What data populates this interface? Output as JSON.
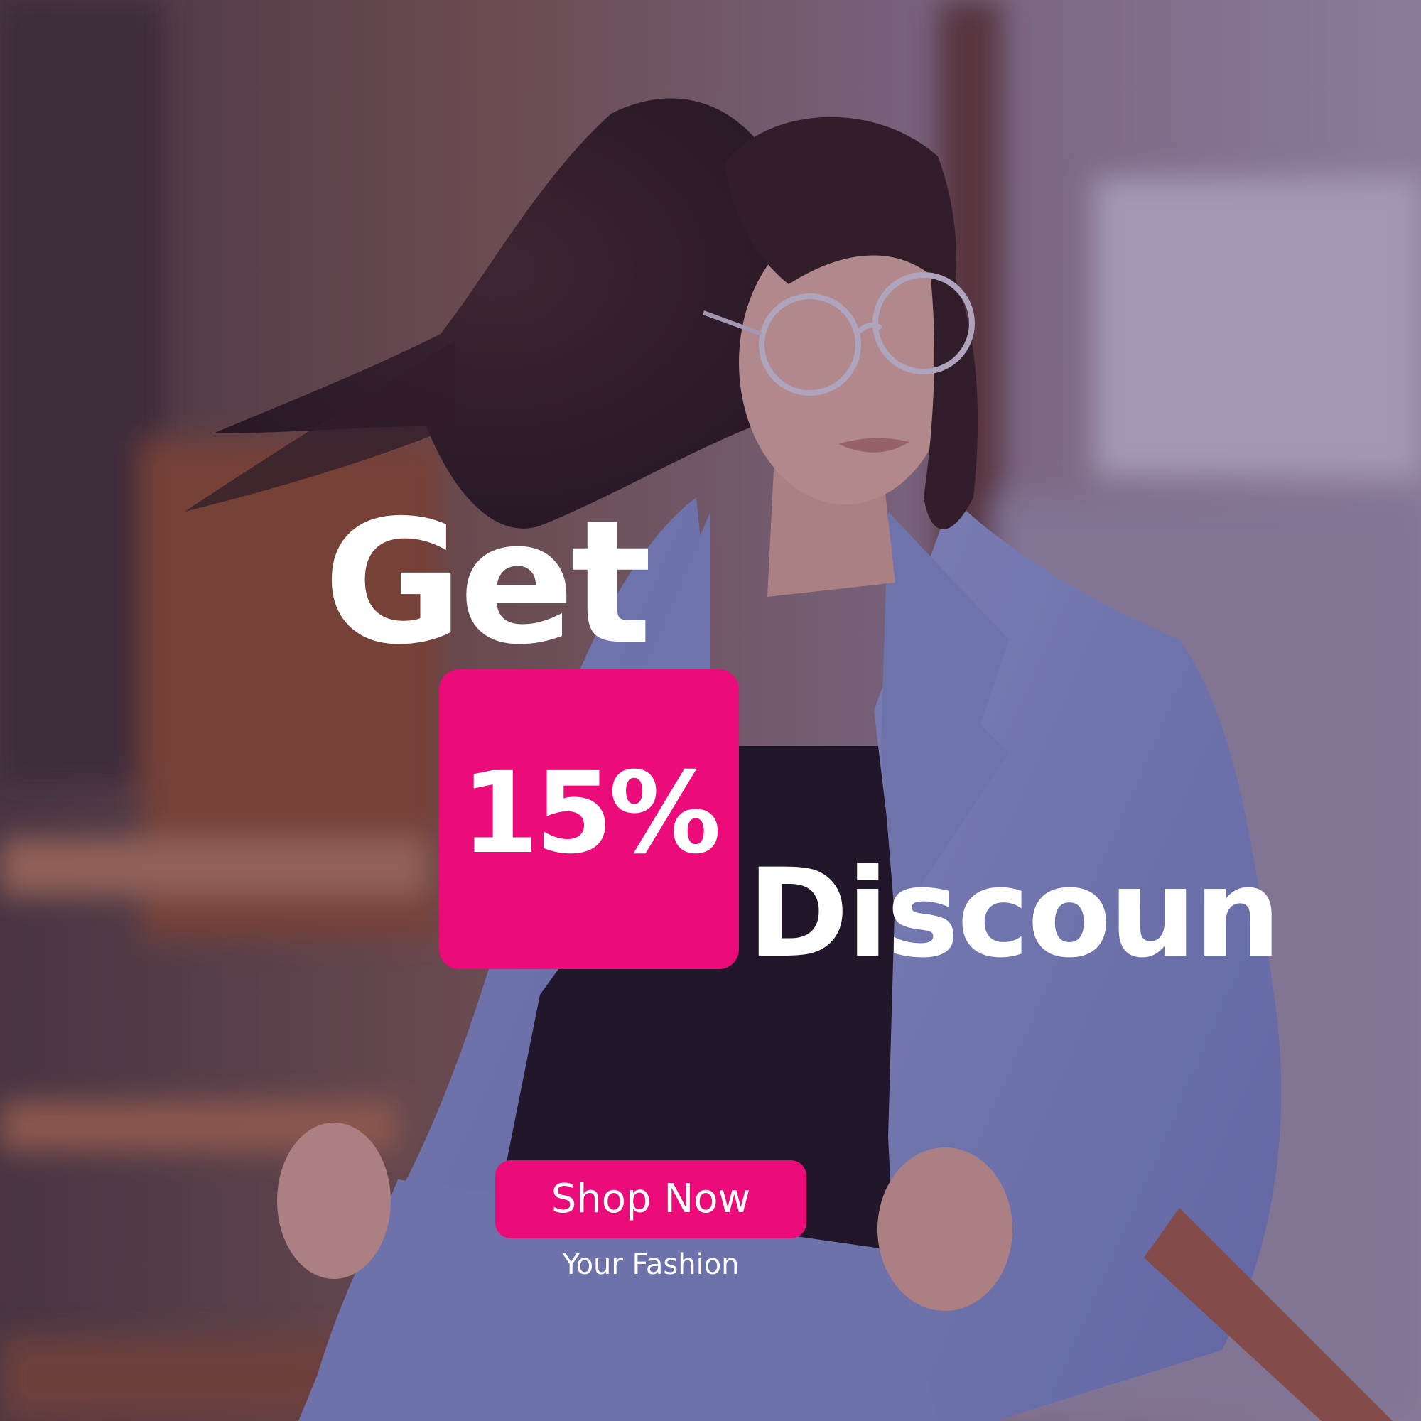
{
  "banner": {
    "headline_top": "Get",
    "badge_value": "15%",
    "headline_bottom": "Discoun",
    "cta_label": "Shop Now",
    "tagline": "Your Fashion"
  },
  "colors": {
    "accent": "#ec0c79",
    "text": "#ffffff",
    "overlay": "#46285a"
  },
  "image": {
    "subject": "woman-in-blue-corduroy-blazer-and-glasses"
  }
}
